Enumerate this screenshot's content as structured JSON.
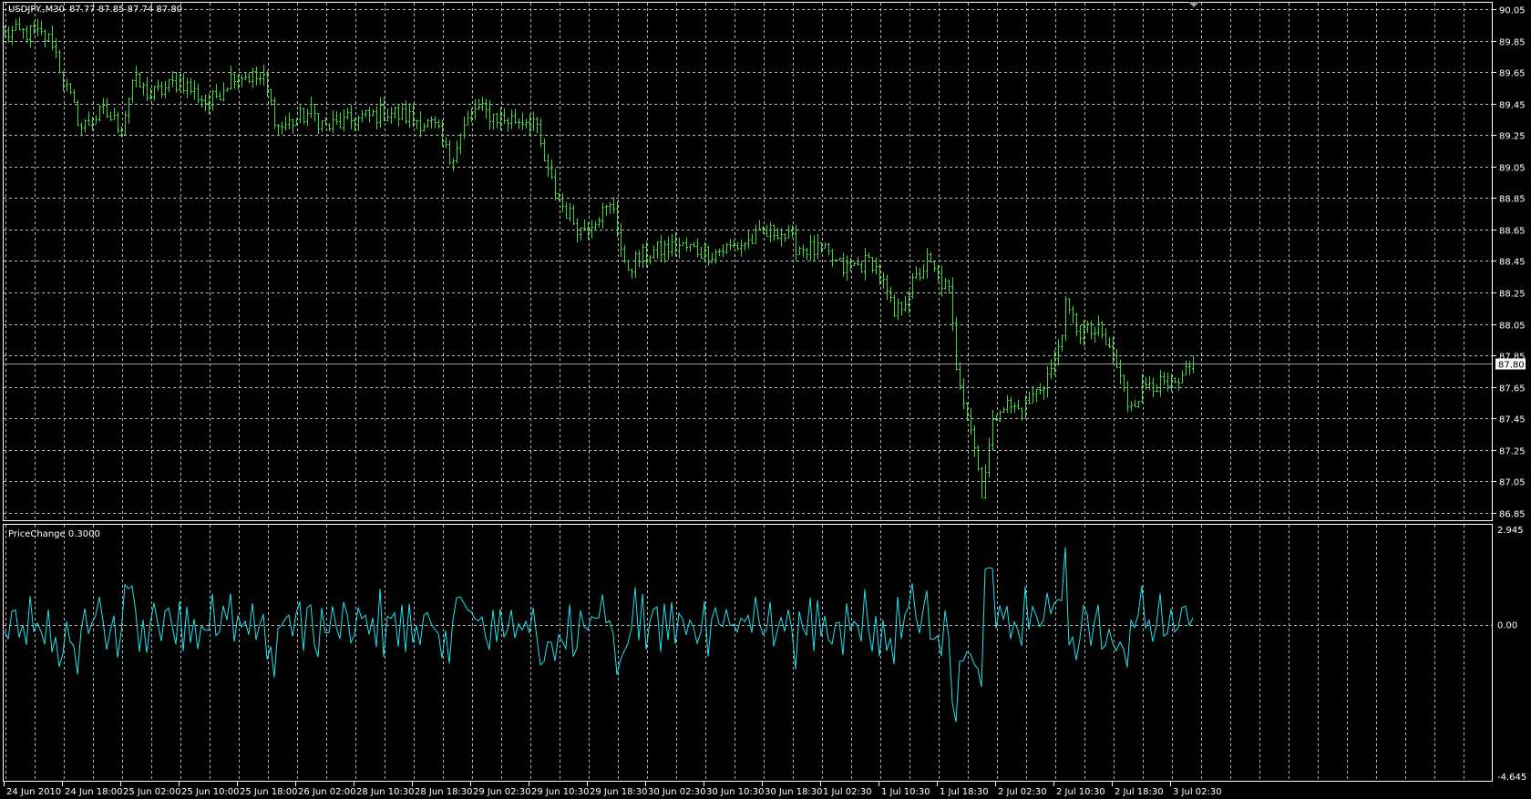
{
  "header": {
    "symbol": "USDJPY.,M30",
    "ohlc_text": "87.77 87.85 87.74 87.80"
  },
  "indicator": {
    "label": "PriceChange 0.3000"
  },
  "colors": {
    "background": "#000000",
    "bars": "#3fd43f",
    "indicator_line": "#22e0ee",
    "grid": "#b8b8b8",
    "axis": "#ffffff"
  },
  "chart_data": [
    {
      "type": "ohlc",
      "title": "USDJPY.,M30",
      "timeframe": "M30",
      "last_bar": {
        "open": 87.77,
        "high": 87.85,
        "low": 87.74,
        "close": 87.8
      },
      "current_price": 87.8,
      "current_price_label": "87.80",
      "ylim": [
        86.85,
        90.05
      ],
      "y_ticks": [
        "90.05",
        "89.85",
        "89.65",
        "89.45",
        "89.25",
        "89.05",
        "88.85",
        "88.65",
        "88.45",
        "88.25",
        "88.05",
        "87.85",
        "87.65",
        "87.45",
        "87.25",
        "87.05",
        "86.85"
      ],
      "x_ticks": [
        "24 Jun 2010",
        "24 Jun 18:00",
        "25 Jun 02:00",
        "25 Jun 10:00",
        "25 Jun 18:00",
        "26 Jun 02:00",
        "28 Jun 10:30",
        "28 Jun 18:30",
        "29 Jun 02:30",
        "29 Jun 10:30",
        "29 Jun 18:30",
        "30 Jun 02:30",
        "30 Jun 10:30",
        "30 Jun 18:30",
        "1 Jul 02:30",
        "1 Jul 10:30",
        "1 Jul 18:30",
        "2 Jul 02:30",
        "2 Jul 10:30",
        "2 Jul 18:30",
        "3 Jul 02:30"
      ],
      "bars_per_x_tick": 16,
      "bar_count": 327,
      "grid": true,
      "close_anchors_bar_price": [
        [
          0,
          89.9
        ],
        [
          8,
          89.9
        ],
        [
          13,
          89.85
        ],
        [
          16,
          89.6
        ],
        [
          21,
          89.3
        ],
        [
          27,
          89.4
        ],
        [
          32,
          89.3
        ],
        [
          35,
          89.6
        ],
        [
          40,
          89.5
        ],
        [
          48,
          89.6
        ],
        [
          56,
          89.45
        ],
        [
          63,
          89.65
        ],
        [
          71,
          89.6
        ],
        [
          75,
          89.3
        ],
        [
          80,
          89.35
        ],
        [
          84,
          89.4
        ],
        [
          88,
          89.3
        ],
        [
          96,
          89.35
        ],
        [
          105,
          89.4
        ],
        [
          113,
          89.35
        ],
        [
          118,
          89.3
        ],
        [
          122,
          89.1
        ],
        [
          126,
          89.3
        ],
        [
          129,
          89.42
        ],
        [
          137,
          89.35
        ],
        [
          145,
          89.35
        ],
        [
          149,
          89.0
        ],
        [
          153,
          88.8
        ],
        [
          158,
          88.65
        ],
        [
          163,
          88.75
        ],
        [
          167,
          88.8
        ],
        [
          170,
          88.4
        ],
        [
          176,
          88.5
        ],
        [
          185,
          88.55
        ],
        [
          193,
          88.5
        ],
        [
          201,
          88.55
        ],
        [
          212,
          88.65
        ],
        [
          217,
          88.55
        ],
        [
          225,
          88.5
        ],
        [
          230,
          88.4
        ],
        [
          238,
          88.45
        ],
        [
          241,
          88.3
        ],
        [
          244,
          88.1
        ],
        [
          249,
          88.3
        ],
        [
          253,
          88.45
        ],
        [
          259,
          88.25
        ],
        [
          261,
          87.8
        ],
        [
          265,
          87.4
        ],
        [
          268,
          87.0
        ],
        [
          271,
          87.4
        ],
        [
          273,
          87.55
        ],
        [
          279,
          87.5
        ],
        [
          284,
          87.65
        ],
        [
          288,
          87.8
        ],
        [
          291,
          88.15
        ],
        [
          295,
          88.0
        ],
        [
          300,
          88.0
        ],
        [
          304,
          87.85
        ],
        [
          308,
          87.55
        ],
        [
          311,
          87.6
        ],
        [
          314,
          87.7
        ],
        [
          318,
          87.65
        ],
        [
          322,
          87.65
        ],
        [
          326,
          87.8
        ]
      ]
    },
    {
      "type": "line",
      "title": "PriceChange 0.3000",
      "ylim": [
        -4.645,
        2.945
      ],
      "y_ticks": [
        "2.945",
        "0.00",
        "-4.645"
      ],
      "description_of_values": "per-bar price change derived from the OHLC series"
    }
  ]
}
